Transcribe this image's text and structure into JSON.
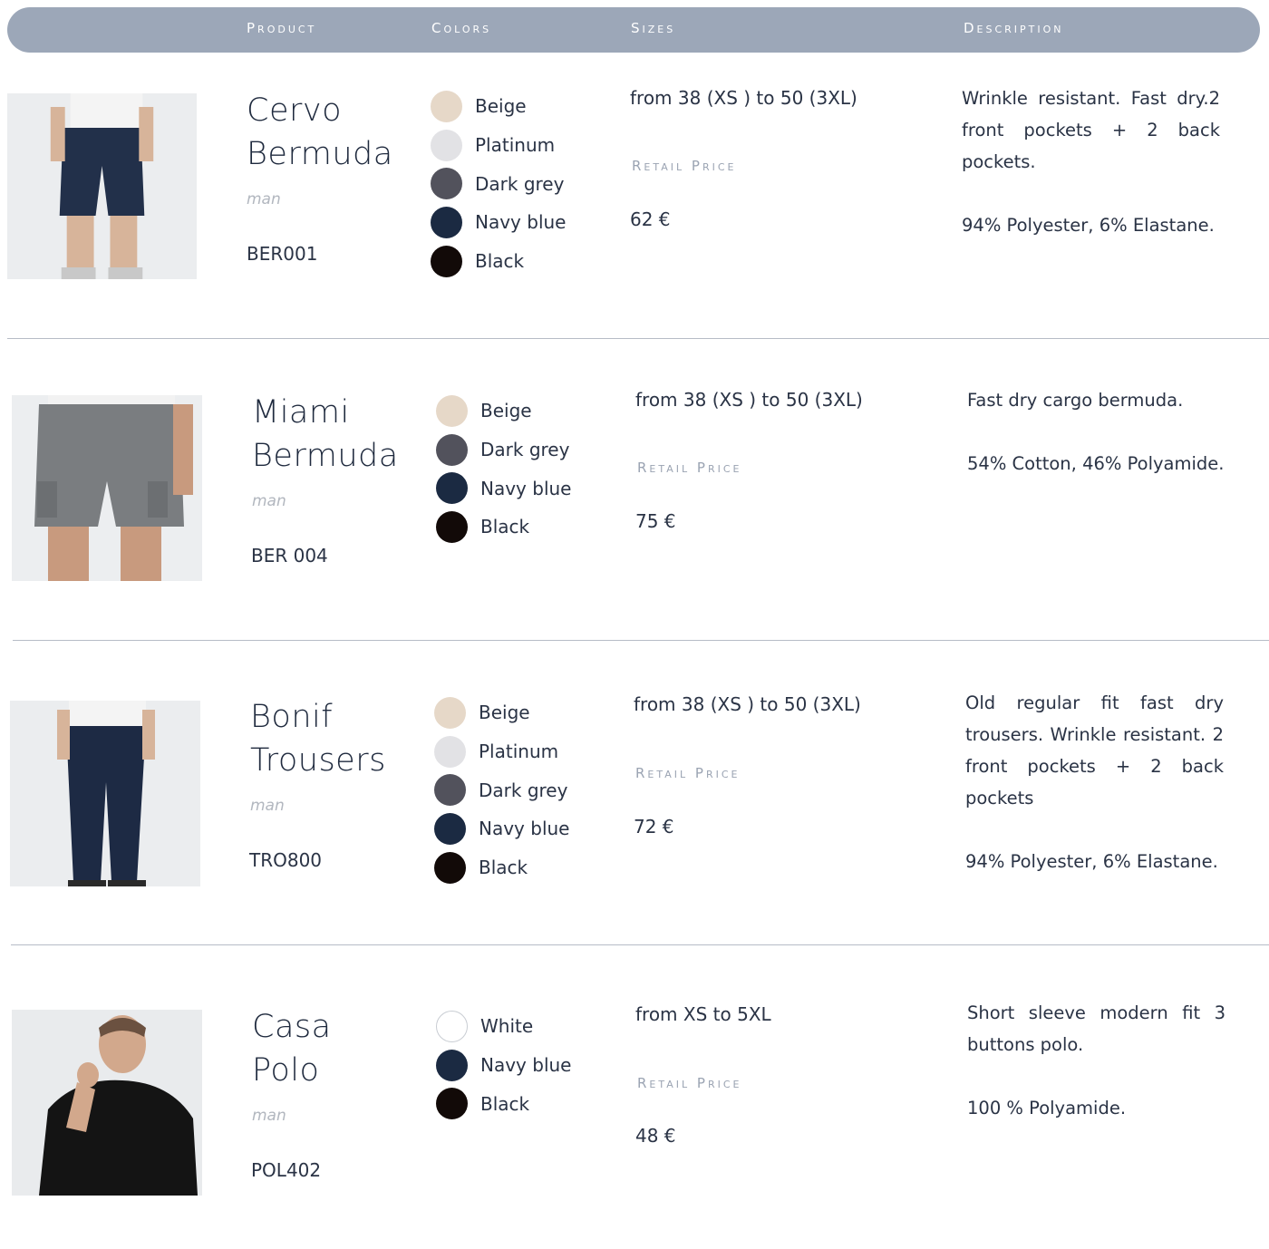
{
  "header": {
    "product": "Product",
    "colors": "Colors",
    "sizes": "Sizes",
    "description": "Description"
  },
  "labels": {
    "retail_price": "Retail Price"
  },
  "products": [
    {
      "name_line1": "Cervo",
      "name_line2": "Bermuda",
      "gender": "man",
      "code": "BER001",
      "sizes": "from 38 (XS ) to 50 (3XL)",
      "price": "62 €",
      "description": [
        "Wrinkle resistant. Fast dry.2 front pockets + 2 back pockets.",
        "94% Polyester, 6% Elastane."
      ],
      "colors": [
        {
          "label": "Beige",
          "hex": "#e6d8c8"
        },
        {
          "label": "Platinum",
          "hex": "#e2e2e5"
        },
        {
          "label": "Dark grey",
          "hex": "#52525c"
        },
        {
          "label": "Navy blue",
          "hex": "#1b2a42"
        },
        {
          "label": "Black",
          "hex": "#120a08"
        }
      ]
    },
    {
      "name_line1": "Miami",
      "name_line2": "Bermuda",
      "gender": "man",
      "code": "BER 004",
      "sizes": "from 38 (XS ) to 50 (3XL)",
      "price": "75 €",
      "description": [
        "Fast dry cargo bermuda.",
        "54%  Cotton, 46% Polyamide."
      ],
      "colors": [
        {
          "label": "Beige",
          "hex": "#e6d8c8"
        },
        {
          "label": "Dark grey",
          "hex": "#52525c"
        },
        {
          "label": "Navy blue",
          "hex": "#1b2a42"
        },
        {
          "label": "Black",
          "hex": "#120a08"
        }
      ]
    },
    {
      "name_line1": "Bonif",
      "name_line2": "Trousers",
      "gender": "man",
      "code": "TRO800",
      "sizes": "from 38 (XS ) to 50 (3XL)",
      "price": "72 €",
      "description": [
        "Old regular fit fast dry  trousers. Wrinkle resistant. 2 front pockets + 2 back pockets",
        "94% Polyester, 6% Elastane."
      ],
      "colors": [
        {
          "label": "Beige",
          "hex": "#e6d8c8"
        },
        {
          "label": "Platinum",
          "hex": "#e2e2e5"
        },
        {
          "label": "Dark grey",
          "hex": "#52525c"
        },
        {
          "label": "Navy blue",
          "hex": "#1b2a42"
        },
        {
          "label": "Black",
          "hex": "#120a08"
        }
      ]
    },
    {
      "name_line1": "Casa",
      "name_line2": "Polo",
      "gender": "man",
      "code": "POL402",
      "sizes": "from XS to 5XL",
      "price": "48 €",
      "description": [
        "Short sleeve modern fit 3 buttons polo.",
        "100 % Polyamide."
      ],
      "colors": [
        {
          "label": "White",
          "hex": "#ffffff"
        },
        {
          "label": "Navy blue",
          "hex": "#1b2a42"
        },
        {
          "label": "Black",
          "hex": "#120a08"
        }
      ]
    }
  ]
}
